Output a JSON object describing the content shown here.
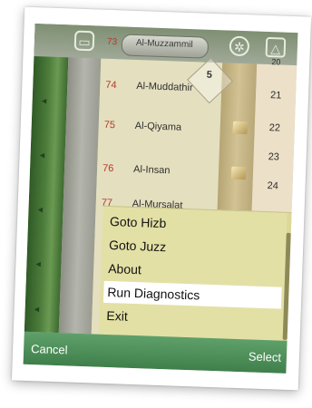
{
  "header": {
    "current_surah": "Al-Muzzammil",
    "current_number": "73",
    "current_page": "20",
    "badge_number": "5"
  },
  "surah_list": [
    {
      "number": "74",
      "name": "Al-Muddathir",
      "page": "21"
    },
    {
      "number": "75",
      "name": "Al-Qiyama",
      "page": "22"
    },
    {
      "number": "",
      "name": "",
      "page": "23"
    },
    {
      "number": "76",
      "name": "Al-Insan",
      "page": "24"
    },
    {
      "number": "77",
      "name": "Al-Mursalat",
      "page": ""
    }
  ],
  "menu": {
    "items": [
      {
        "label": "Goto Hizb",
        "selected": false
      },
      {
        "label": "Goto Juzz",
        "selected": false
      },
      {
        "label": "About",
        "selected": false
      },
      {
        "label": "Run Diagnostics",
        "selected": true
      },
      {
        "label": "Exit",
        "selected": false
      }
    ]
  },
  "softkeys": {
    "left": "Cancel",
    "right": "Select"
  },
  "icons": {
    "header_left": "frame-icon",
    "header_gear": "gear-icon",
    "header_mosque": "mosque-icon"
  },
  "colors": {
    "menu_bg": "#e3e0a6",
    "softkey_bar": "#4f8f58",
    "surah_number": "#b23a2a",
    "green_band": "#3d6a30"
  }
}
